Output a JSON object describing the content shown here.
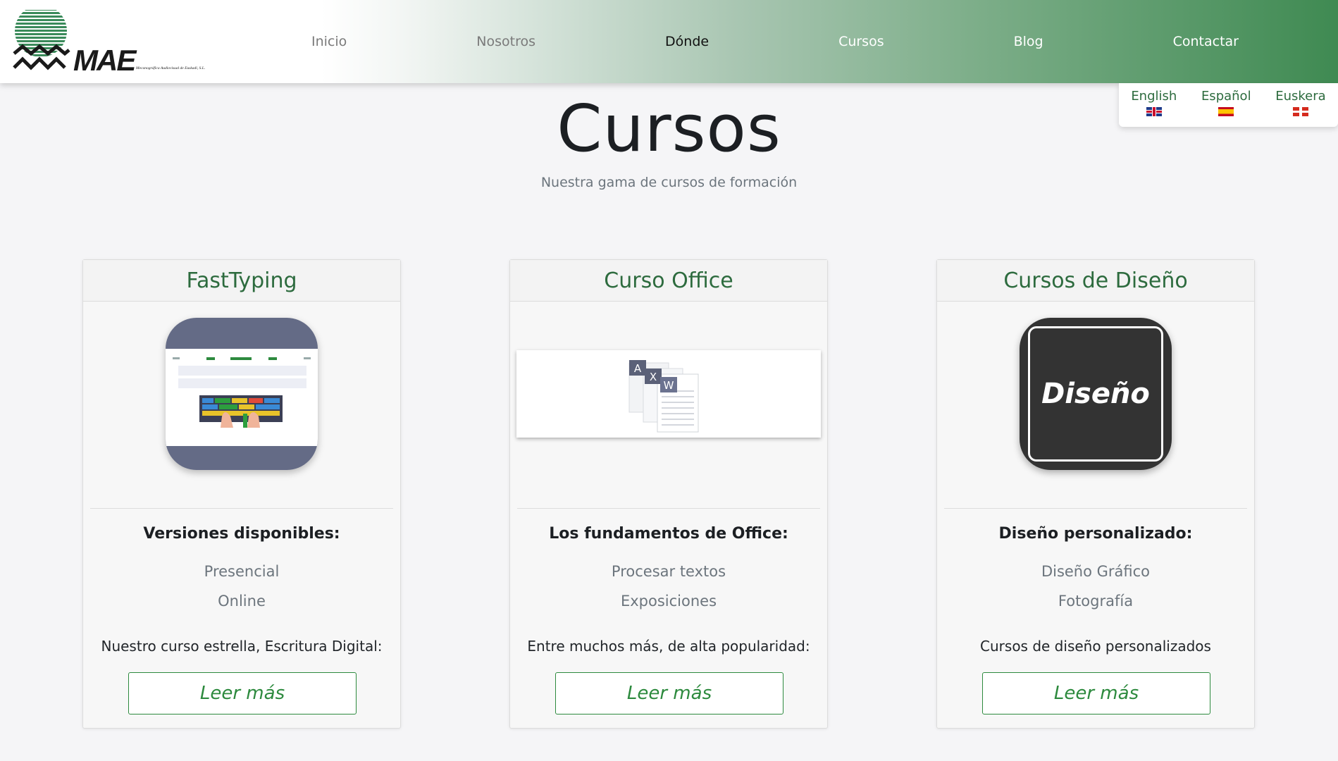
{
  "header": {
    "logo_text": "MAE",
    "logo_caption": "Mecanográfica Audiovisual de Euskadi, S.L.",
    "nav": [
      {
        "label": "Inicio"
      },
      {
        "label": "Nosotros"
      },
      {
        "label": "Dónde"
      },
      {
        "label": "Cursos"
      },
      {
        "label": "Blog"
      },
      {
        "label": "Contactar"
      }
    ],
    "active_item": "Dónde"
  },
  "languages": [
    {
      "label": "English",
      "flag": "uk-flag-icon"
    },
    {
      "label": "Español",
      "flag": "spain-flag-icon"
    },
    {
      "label": "Euskera",
      "flag": "basque-flag-icon"
    }
  ],
  "page": {
    "title": "Cursos",
    "subtitle": "Nuestra gama de cursos de formación"
  },
  "cards": [
    {
      "title": "FastTyping",
      "heading": "Versiones disponibles:",
      "items": [
        "Presencial",
        "Online"
      ],
      "text": "Nuestro curso estrella, Escritura Digital:",
      "button": "Leer más"
    },
    {
      "title": "Curso Office",
      "heading": "Los fundamentos de Office:",
      "items": [
        "Procesar textos",
        "Exposiciones"
      ],
      "text": "Entre muchos más, de alta popularidad:",
      "button": "Leer más",
      "image_letters": [
        "A",
        "X",
        "W"
      ]
    },
    {
      "title": "Cursos de Diseño",
      "heading": "Diseño personalizado:",
      "items": [
        "Diseño Gráfico",
        "Fotografía"
      ],
      "text": "Cursos de diseño personalizados",
      "button": "Leer más",
      "image_text": "Diseño"
    }
  ],
  "colors": {
    "accent_green": "#2d6b3e",
    "button_green": "#2d8a3e",
    "header_gradient_end": "#3f8a52",
    "background": "#f5f5f7"
  }
}
